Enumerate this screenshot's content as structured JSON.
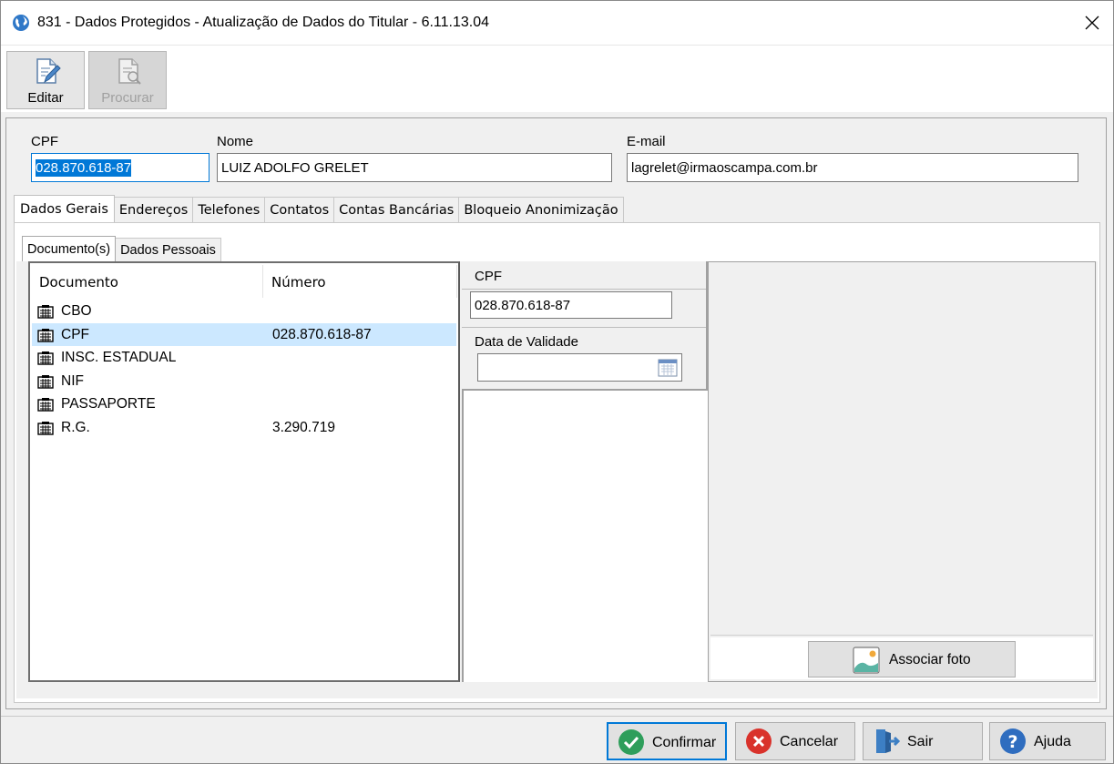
{
  "window": {
    "title": "831 - Dados Protegidos - Atualização de Dados do Titular - 6.11.13.04"
  },
  "toolbar": {
    "edit_label": "Editar",
    "search_label": "Procurar"
  },
  "header": {
    "cpf_label": "CPF",
    "cpf_value": "028.870.618-87",
    "name_label": "Nome",
    "name_value": "LUIZ ADOLFO GRELET",
    "email_label": "E-mail",
    "email_value": "lagrelet@irmaoscampa.com.br"
  },
  "tabs": [
    {
      "label": "Dados Gerais"
    },
    {
      "label": "Endereços"
    },
    {
      "label": "Telefones"
    },
    {
      "label": "Contatos"
    },
    {
      "label": "Contas Bancárias"
    },
    {
      "label": "Bloqueio Anonimização"
    }
  ],
  "subtabs": [
    {
      "label": "Documento(s)"
    },
    {
      "label": "Dados Pessoais"
    }
  ],
  "documents": {
    "col_document": "Documento",
    "col_number": "Número",
    "rows": [
      {
        "name": "CBO",
        "number": ""
      },
      {
        "name": "CPF",
        "number": "028.870.618-87"
      },
      {
        "name": "INSC. ESTADUAL",
        "number": ""
      },
      {
        "name": "NIF",
        "number": ""
      },
      {
        "name": "PASSAPORTE",
        "number": ""
      },
      {
        "name": "R.G.",
        "number": "3.290.719"
      }
    ],
    "selected_index": 1
  },
  "detail": {
    "doc_label": "CPF",
    "doc_value": "028.870.618-87",
    "validity_label": "Data de Validade",
    "validity_value": ""
  },
  "photo": {
    "associate_label": "Associar foto"
  },
  "footer": {
    "confirm_label": "Confirmar",
    "cancel_label": "Cancelar",
    "exit_label": "Sair",
    "help_label": "Ajuda"
  },
  "colors": {
    "selection": "#0078d7",
    "row_highlight": "#cce8ff",
    "confirm_icon": "#2e9e5b",
    "cancel_icon": "#d9322b",
    "help_icon": "#2f6dbf",
    "exit_icon": "#3d7fc4"
  }
}
